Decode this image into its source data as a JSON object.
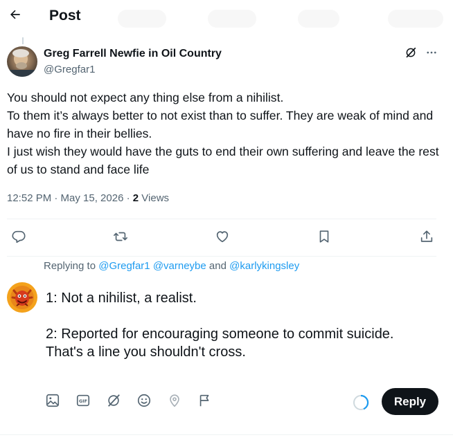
{
  "header": {
    "title": "Post"
  },
  "post": {
    "author_name": "Greg Farrell Newfie in Oil Country",
    "author_handle": "@Gregfar1",
    "text_lines": [
      "You should not expect any thing else from a nihilist.",
      "To them it’s always better to not exist than to suffer. They are weak of mind and have no fire in their bellies.",
      "I just wish they would have the guts to end their own suffering and leave the rest of us to stand and face life"
    ],
    "time": "12:52 PM · May 15, 2026",
    "separator": " · ",
    "views_count": "2",
    "views_label": " Views"
  },
  "replying": {
    "prefix": "Replying to ",
    "mention1": "@Gregfar1",
    "mention2": "@varneybe",
    "joiner": " and ",
    "mention3": "@karlykingsley"
  },
  "composer": {
    "line1": "1: Not a nihilist, a realist.",
    "line2": "2: Reported for encouraging someone to commit suicide. That's a line you shouldn't cross."
  },
  "reply_button": {
    "label": "Reply"
  },
  "icons": {
    "back": "arrow-left-icon",
    "grok": "grok-icon",
    "more": "more-icon",
    "reply": "reply-icon",
    "repost": "repost-icon",
    "like": "heart-icon",
    "bookmark": "bookmark-icon",
    "share": "share-icon",
    "media": "image-icon",
    "gif": "gif-icon",
    "grok_tool": "grok-icon",
    "emoji": "emoji-icon",
    "location": "location-icon",
    "schedule": "flag-icon"
  },
  "colors": {
    "accent": "#1d9bf0",
    "text": "#0f1419",
    "secondary": "#536471",
    "button": "#0f1419"
  }
}
